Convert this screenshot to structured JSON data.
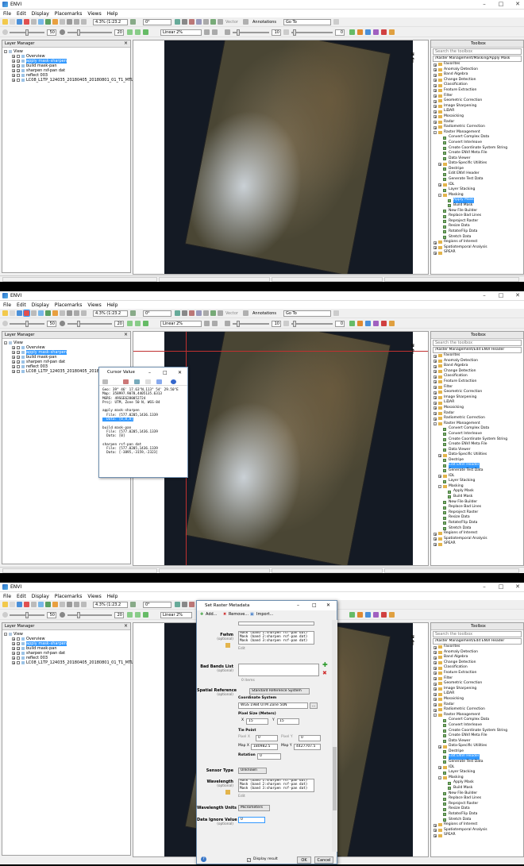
{
  "app": {
    "title": "ENVI",
    "menu": [
      "File",
      "Edit",
      "Display",
      "Placemarks",
      "Views",
      "Help"
    ]
  },
  "toolbar": {
    "zoom": "4.3% (1:23.2",
    "rotation": "0°",
    "vector_label": "Vector",
    "annotations_label": "Annotations",
    "goto_label": "Go To",
    "brightness": "50",
    "contrast": "20",
    "stretch": "Linear 2%",
    "sharpen": "10",
    "transparency": "0"
  },
  "layer_manager": {
    "title": "Layer Manager",
    "root": "View",
    "items": [
      "Overview",
      "apply mask-sharpen",
      "build mask-pan",
      "sharpen rsf-pan dat",
      "reflect 003",
      "LC08_L1TP_124035_20180405_20180801_01_T1_MTL_Multi"
    ],
    "items_s2": [
      "Overview",
      "apply mask-sharpen",
      "build mask-pan",
      "sharpen rsf-pan dat",
      "reflect 003",
      "LC08_L1TP_124035_20180405_20180801"
    ],
    "items_s3": [
      "Overview",
      "apply mask-sharpen",
      "build mask-pan",
      "sharpen rsf-pan dat",
      "reflect 003",
      "LC08_L1TP_124035_20180405_20180801_01_T1_MTL_Multi"
    ]
  },
  "north_arrow": "N",
  "toolbox": {
    "title": "Toolbox",
    "search_placeholder": "Search the toolbox",
    "path_s1": "/Raster Management/Masking/Apply Mask",
    "path_s2": "/Raster Management/Edit ENVI Header",
    "items": [
      "Favorites",
      "Anomaly Detection",
      "Band Algebra",
      "Change Detection",
      "Classification",
      "Feature Extraction",
      "Filter",
      "Geometric Correction",
      "Image Sharpening",
      "LiDAR",
      "Mosaicking",
      "Radar",
      "Radiometric Correction",
      "Raster Management",
      "Convert Complex Data",
      "Convert Interleave",
      "Create Coordinate System String",
      "Create ENVI Meta File",
      "Data Viewer",
      "Data-Specific Utilities",
      "Destripe",
      "Edit ENVI Header",
      "Generate Test Data",
      "IDL",
      "Layer Stacking",
      "Masking",
      "Apply Mask",
      "Build Mask",
      "New File Builder",
      "Replace Bad Lines",
      "Reproject Raster",
      "Resize Data",
      "Rotate/Flip Data",
      "Stretch Data",
      "Regions of Interest",
      "Spatiotemporal Analysis",
      "SPEAR"
    ]
  },
  "cursor_value": {
    "title": "Cursor Value",
    "lines": [
      "Geo: 39° 46' 17.63\"N,113° 54' 29.50\"E",
      "Map: 358997.9078,4405135.6313",
      "MGRS: 49SGE6280052724",
      "Proj: UTM, Zone 50 N, WGS-84",
      "",
      "apply mask-sharpen",
      "  File: [577.0205,1436.1339",
      "  Data: [0,0,0]",
      "",
      "build mask-pan",
      "  File: [577.0205,1436.1339",
      "  Data: [0]",
      "",
      "sharpen rsf-pan dat",
      "  File: [577.0205,1436.1339",
      "  Data: [-3895,-3159,-2323]"
    ]
  },
  "set_raster_metadata": {
    "title": "Set Raster Metadata",
    "add_label": "Add...",
    "remove_label": "Remove...",
    "import_label": "Import...",
    "fwhm_label": "Fwhm",
    "optional": "(optional)",
    "edit_label": "Edit",
    "fwhm_values": [
      "Mask (band 1:sharpen rsf-pan dat)",
      "Mask (band 2:sharpen rsf-pan dat)",
      "Mask (band 3:sharpen rsf-pan dat)"
    ],
    "bad_bands_label": "Bad Bands List",
    "items_count": "0 items",
    "spatial_reference_label": "Spatial Reference",
    "spatial_reference_value": "Standard Reference System",
    "coordinate_system_label": "Coordinate System",
    "coordinate_system_value": "WGS 1984 UTM Zone 50N",
    "pixel_size_label": "Pixel Size (Meters)",
    "pixel_x": "15",
    "pixel_y": "15",
    "tie_point_label": "Tie Point",
    "pixel_x_label": "Pixel X",
    "pixel_y_label": "Pixel Y",
    "pixel_x_value": "0",
    "pixel_y_value": "0",
    "map_x_label": "Map X",
    "map_y_label": "Map Y",
    "map_x_value": "180982.5",
    "map_y_value": "4427707.5",
    "rotation_label": "Rotation",
    "rotation_value": "0",
    "sensor_type_label": "Sensor Type",
    "sensor_type_value": "Unknown",
    "wavelength_label": "Wavelength",
    "wavelength_values": [
      "Mask (band 1:sharpen rsf-pan dat)",
      "Mask (band 2:sharpen rsf-pan dat)",
      "Mask (band 3:sharpen rsf-pan dat)"
    ],
    "wavelength_units_label": "Wavelength Units",
    "wavelength_units_value": "Micrometers",
    "data_ignore_label": "Data Ignore Value",
    "data_ignore_value": "0",
    "display_result_label": "Display result",
    "ok_label": "OK",
    "cancel_label": "Cancel"
  }
}
